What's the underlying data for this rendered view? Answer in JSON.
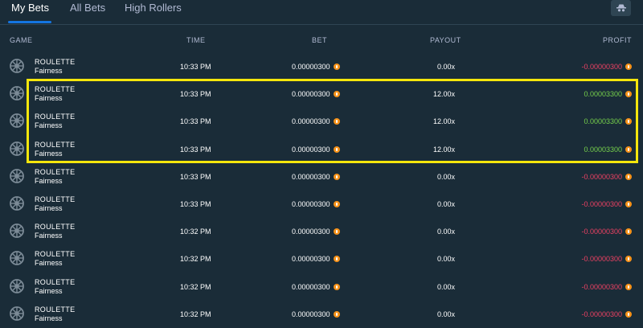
{
  "tabs": [
    {
      "label": "My Bets"
    },
    {
      "label": "All Bets"
    },
    {
      "label": "High Rollers"
    }
  ],
  "headers": {
    "game": "GAME",
    "time": "TIME",
    "bet": "BET",
    "payout": "PAYOUT",
    "profit": "PROFIT"
  },
  "colors": {
    "positive": "#76d04b",
    "negative": "#ed4163",
    "highlight": "#f5e60c",
    "coin": "#f7931a"
  },
  "rows": [
    {
      "game": "ROULETTE",
      "sub": "Fairness",
      "time": "10:33 PM",
      "bet": "0.00000300",
      "payout": "0.00x",
      "profit": "-0.00000300",
      "win": false
    },
    {
      "game": "ROULETTE",
      "sub": "Fairness",
      "time": "10:33 PM",
      "bet": "0.00000300",
      "payout": "12.00x",
      "profit": "0.00003300",
      "win": true
    },
    {
      "game": "ROULETTE",
      "sub": "Fairness",
      "time": "10:33 PM",
      "bet": "0.00000300",
      "payout": "12.00x",
      "profit": "0.00003300",
      "win": true
    },
    {
      "game": "ROULETTE",
      "sub": "Fairness",
      "time": "10:33 PM",
      "bet": "0.00000300",
      "payout": "12.00x",
      "profit": "0.00003300",
      "win": true
    },
    {
      "game": "ROULETTE",
      "sub": "Fairness",
      "time": "10:33 PM",
      "bet": "0.00000300",
      "payout": "0.00x",
      "profit": "-0.00000300",
      "win": false
    },
    {
      "game": "ROULETTE",
      "sub": "Fairness",
      "time": "10:33 PM",
      "bet": "0.00000300",
      "payout": "0.00x",
      "profit": "-0.00000300",
      "win": false
    },
    {
      "game": "ROULETTE",
      "sub": "Fairness",
      "time": "10:32 PM",
      "bet": "0.00000300",
      "payout": "0.00x",
      "profit": "-0.00000300",
      "win": false
    },
    {
      "game": "ROULETTE",
      "sub": "Fairness",
      "time": "10:32 PM",
      "bet": "0.00000300",
      "payout": "0.00x",
      "profit": "-0.00000300",
      "win": false
    },
    {
      "game": "ROULETTE",
      "sub": "Fairness",
      "time": "10:32 PM",
      "bet": "0.00000300",
      "payout": "0.00x",
      "profit": "-0.00000300",
      "win": false
    },
    {
      "game": "ROULETTE",
      "sub": "Fairness",
      "time": "10:32 PM",
      "bet": "0.00000300",
      "payout": "0.00x",
      "profit": "-0.00000300",
      "win": false
    }
  ]
}
